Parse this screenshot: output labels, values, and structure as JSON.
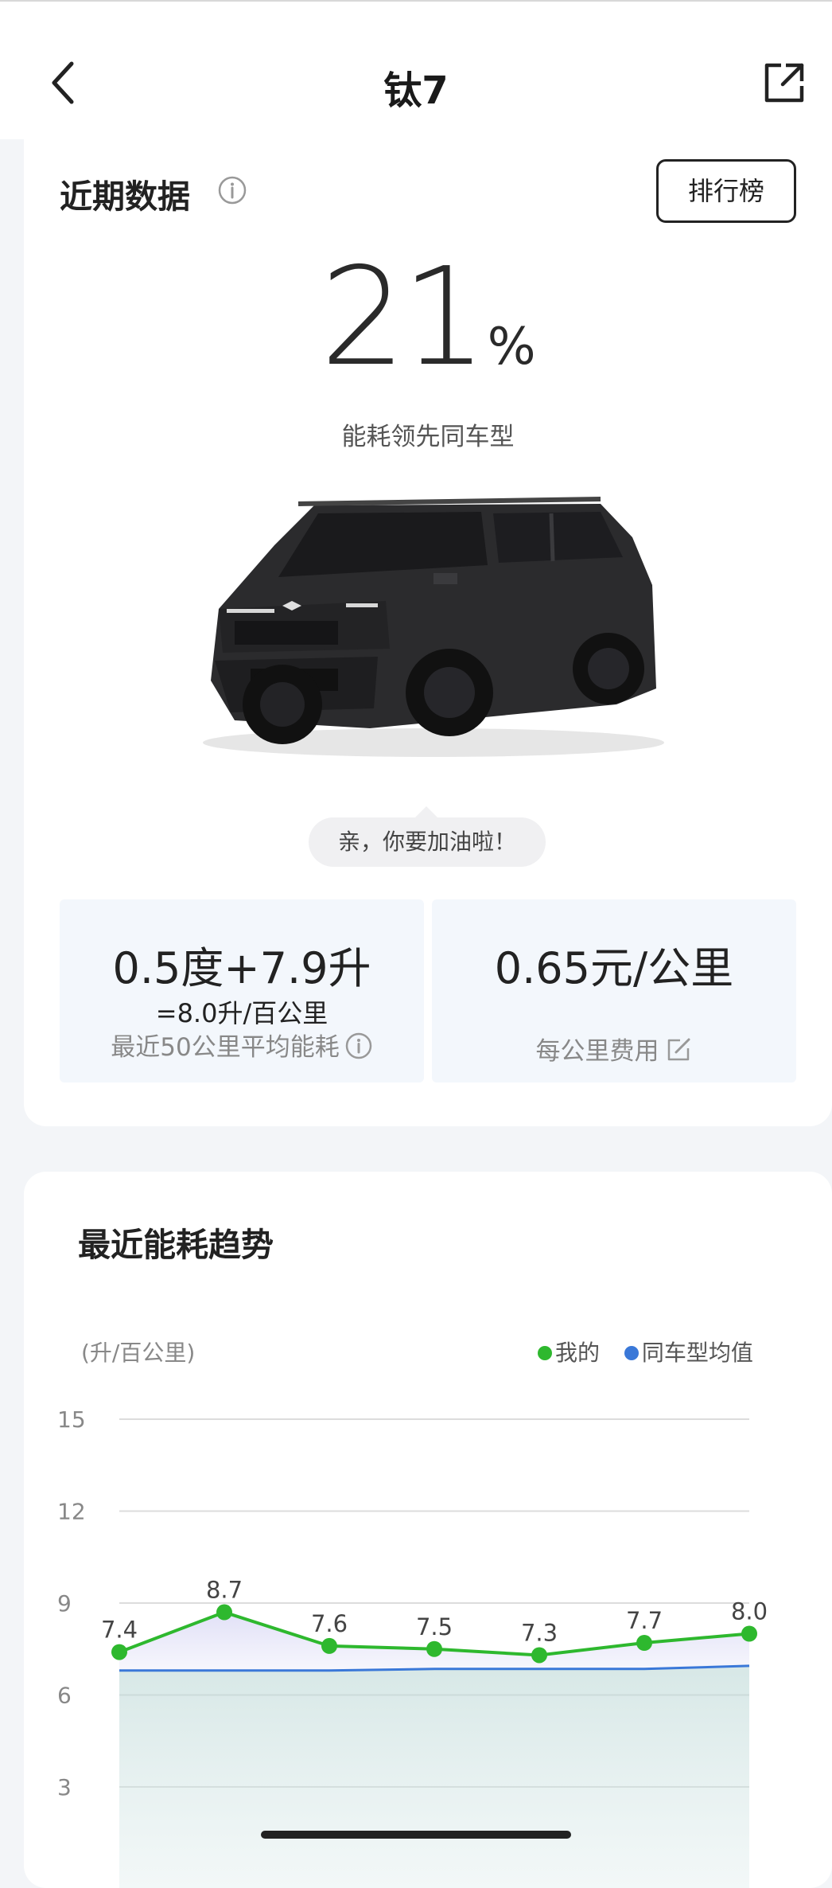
{
  "header": {
    "title": "钛7",
    "back_icon": "chevron-left-icon",
    "share_icon": "external-share-icon"
  },
  "recent": {
    "title": "近期数据",
    "rank_button": "排行榜",
    "percent_value": "21",
    "percent_unit": "%",
    "caption": "能耗领先同车型",
    "bubble": "亲，你要加油啦！",
    "stat_left": {
      "main": "0.5度+7.9升",
      "sub": "=8.0升/百公里",
      "caption": "最近50公里平均能耗"
    },
    "stat_right": {
      "main": "0.65元/公里",
      "caption": "每公里费用"
    }
  },
  "trend": {
    "title": "最近能耗趋势"
  },
  "chart_data": {
    "type": "line",
    "ylabel": "(升/百公里)",
    "y_ticks": [
      "15",
      "12",
      "9",
      "6",
      "3"
    ],
    "ylim": [
      2,
      15
    ],
    "grid": true,
    "legend_position": "top-right",
    "colors": {
      "mine": "#2eb82e",
      "avg": "#3a78d8"
    },
    "series": [
      {
        "name": "我的",
        "values": [
          7.4,
          8.7,
          7.6,
          7.5,
          7.3,
          7.7,
          8.0
        ],
        "labels": [
          "7.4",
          "8.7",
          "7.6",
          "7.5",
          "7.3",
          "7.7",
          "8.0"
        ]
      },
      {
        "name": "同车型均值",
        "values": [
          6.8,
          6.8,
          6.8,
          6.85,
          6.85,
          6.85,
          6.95
        ]
      }
    ]
  }
}
